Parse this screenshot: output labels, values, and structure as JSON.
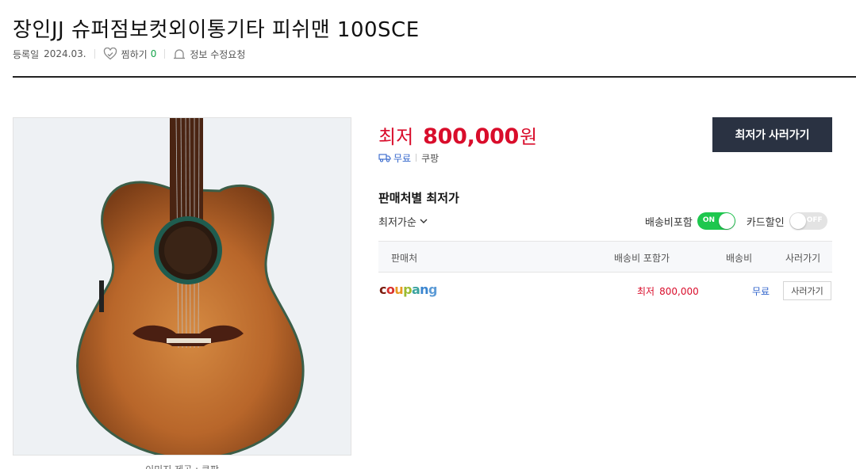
{
  "product": {
    "title": "장인JJ 슈퍼점보컷외이통기타 피쉬맨 100SCE",
    "registered_label": "등록일",
    "registered_date": "2024.03.",
    "zzim_label": "찜하기",
    "zzim_count": "0",
    "report_label": "정보 수정요청",
    "image_caption": "이미지 제공 : 쿠팡"
  },
  "price": {
    "label": "최저",
    "value": "800,000",
    "unit": "원"
  },
  "shipping": {
    "fee": "무료",
    "mall": "쿠팡"
  },
  "buy_button": "최저가 사러가기",
  "sellers_section": {
    "title": "판매처별 최저가",
    "sort_label": "최저가순",
    "shipping_toggle_label": "배송비포함",
    "shipping_toggle_state": "ON",
    "card_toggle_label": "카드할인",
    "card_toggle_state": "OFF",
    "columns": {
      "seller": "판매처",
      "total": "배송비 포함가",
      "shipping": "배송비",
      "buy": "사러가기"
    },
    "rows": [
      {
        "seller": "coupang",
        "price_label": "최저",
        "price": "800,000",
        "shipping": "무료",
        "buy": "사러가기"
      }
    ]
  },
  "colors": {
    "price_red": "#d90d2b",
    "button_dark": "#2a3242",
    "toggle_green": "#1ec74e",
    "link_blue": "#3366cc"
  }
}
